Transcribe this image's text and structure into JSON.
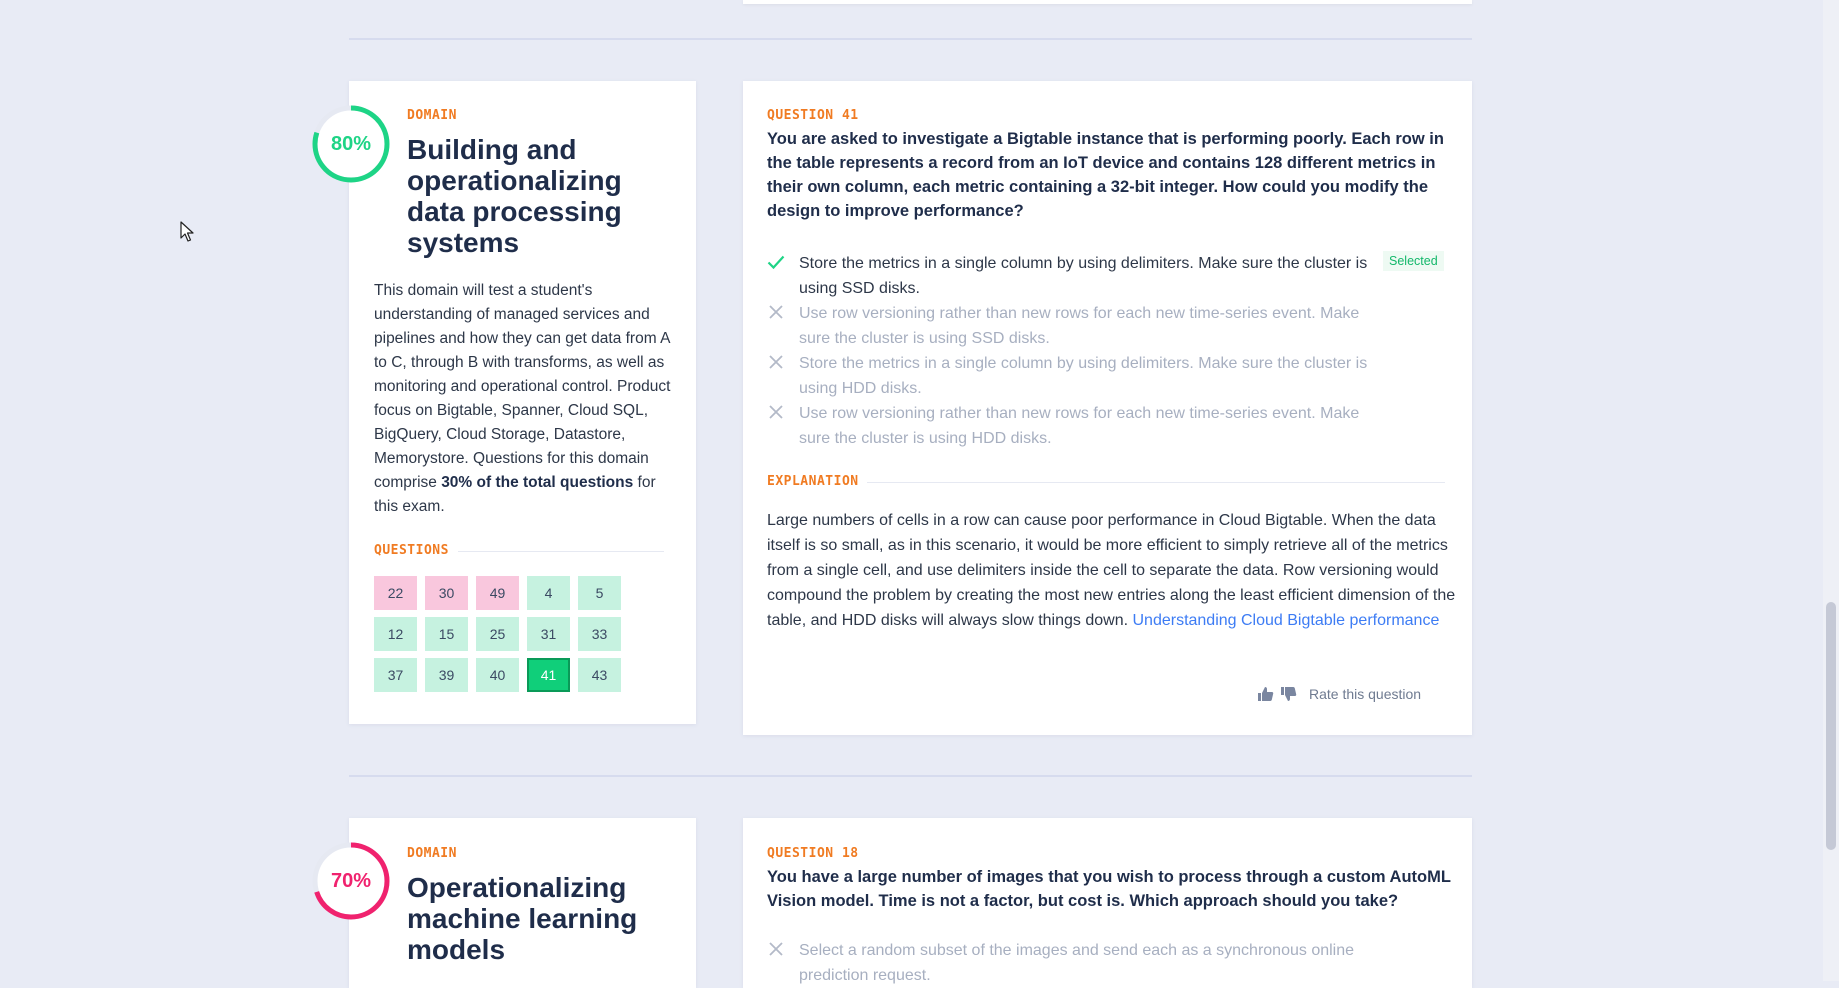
{
  "section1": {
    "score": "80%",
    "score_value": 80,
    "score_color": "#1ed486",
    "eyebrow": "DOMAIN",
    "title": "Building and operationalizing data processing systems",
    "description_before": "This domain will test a student's understanding of managed services and pipelines and how they can get data from A to C, through B with transforms, as well as monitoring and operational control. Product focus on Bigtable, Spanner, Cloud SQL, BigQuery, Cloud Storage, Datastore, Memorystore. Questions for this domain comprise ",
    "description_bold": "30% of the total questions",
    "description_after": " for this exam.",
    "questions_label": "QUESTIONS",
    "questions": [
      {
        "n": "22",
        "status": "wrong"
      },
      {
        "n": "30",
        "status": "wrong"
      },
      {
        "n": "49",
        "status": "wrong"
      },
      {
        "n": "4",
        "status": "right"
      },
      {
        "n": "5",
        "status": "right"
      },
      {
        "n": "12",
        "status": "right"
      },
      {
        "n": "15",
        "status": "right"
      },
      {
        "n": "25",
        "status": "right"
      },
      {
        "n": "31",
        "status": "right"
      },
      {
        "n": "33",
        "status": "right"
      },
      {
        "n": "37",
        "status": "right"
      },
      {
        "n": "39",
        "status": "right"
      },
      {
        "n": "40",
        "status": "right"
      },
      {
        "n": "41",
        "status": "current"
      },
      {
        "n": "43",
        "status": "right"
      }
    ]
  },
  "question1": {
    "eyebrow": "QUESTION 41",
    "text": "You are asked to investigate a Bigtable instance that is performing poorly. Each row in the table represents a record from an IoT device and contains 128 different metrics in their own column, each metric containing a 32-bit integer. How could you modify the design to improve performance?",
    "options": [
      {
        "text": "Store the metrics in a single column by using delimiters. Make sure the cluster is using SSD disks.",
        "icon": "check-icon",
        "selected": true
      },
      {
        "text": "Use row versioning rather than new rows for each new time-series event. Make sure the cluster is using SSD disks.",
        "icon": "x-icon",
        "selected": false
      },
      {
        "text": "Store the metrics in a single column by using delimiters. Make sure the cluster is using HDD disks.",
        "icon": "x-icon",
        "selected": false
      },
      {
        "text": "Use row versioning rather than new rows for each new time-series event. Make sure the cluster is using HDD disks.",
        "icon": "x-icon",
        "selected": false
      }
    ],
    "selected_badge": "Selected",
    "explanation_label": "EXPLANATION",
    "explanation": "Large numbers of cells in a row can cause poor performance in Cloud Bigtable. When the data itself is so small, as in this scenario, it would be more efficient to simply retrieve all of the metrics from a single cell, and use delimiters inside the cell to separate the data. Row versioning would compound the problem by creating the most new entries along the least efficient dimension of the table, and HDD disks will always slow things down. ",
    "link_text": "Understanding Cloud Bigtable performance",
    "rate_label": "Rate this question"
  },
  "section2": {
    "score": "70%",
    "score_value": 70,
    "score_color": "#f0226e",
    "eyebrow": "DOMAIN",
    "title": "Operationalizing machine learning models"
  },
  "question2": {
    "eyebrow": "QUESTION 18",
    "text": "You have a large number of images that you wish to process through a custom AutoML Vision model. Time is not a factor, but cost is. Which approach should you take?",
    "first_option": "Select a random subset of the images and send each as a synchronous online prediction request."
  },
  "colors": {
    "accent_orange": "#f07b22",
    "correct_green": "#1ed486",
    "wrong_pink": "#f9c7dd",
    "link_blue": "#3d7cf4"
  }
}
